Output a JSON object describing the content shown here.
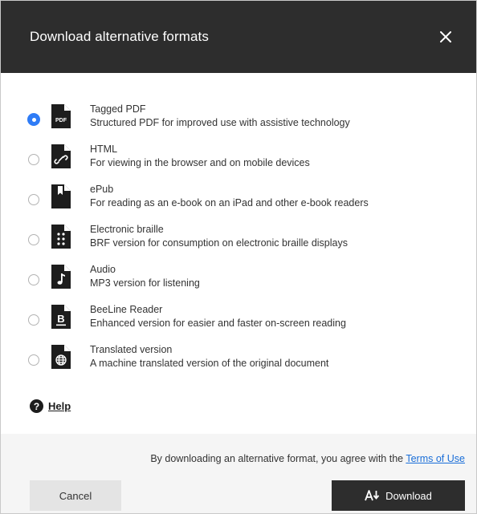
{
  "dialog": {
    "title": "Download alternative formats",
    "close_icon": "close-icon"
  },
  "options": [
    {
      "name": "Tagged PDF",
      "description": "Structured PDF for improved use with assistive technology",
      "selected": true,
      "icon": "pdf-file-icon",
      "icon_label": "PDF"
    },
    {
      "name": "HTML",
      "description": "For viewing in the browser and on mobile devices",
      "selected": false,
      "icon": "html-link-file-icon"
    },
    {
      "name": "ePub",
      "description": "For reading as an e-book on an iPad and other e-book readers",
      "selected": false,
      "icon": "epub-bookmark-file-icon"
    },
    {
      "name": "Electronic braille",
      "description": "BRF version for consumption on electronic braille displays",
      "selected": false,
      "icon": "braille-file-icon"
    },
    {
      "name": "Audio",
      "description": "MP3 version for listening",
      "selected": false,
      "icon": "audio-file-icon"
    },
    {
      "name": "BeeLine Reader",
      "description": "Enhanced version for easier and faster on-screen reading",
      "selected": false,
      "icon": "beeline-file-icon",
      "icon_label": "B"
    },
    {
      "name": "Translated version",
      "description": "A machine translated version of the original document",
      "selected": false,
      "icon": "globe-file-icon"
    }
  ],
  "help": {
    "label": "Help",
    "icon_glyph": "?"
  },
  "footer": {
    "terms_prefix": "By downloading an alternative format, you agree with the ",
    "terms_link": "Terms of Use",
    "cancel_label": "Cancel",
    "download_label": "Download"
  },
  "colors": {
    "header_bg": "#2d2d2d",
    "radio_selected": "#2f7cf6",
    "link": "#1a6ed8",
    "footer_bg": "#f5f5f5",
    "cancel_bg": "#e4e4e4",
    "download_bg": "#2d2d2d"
  }
}
